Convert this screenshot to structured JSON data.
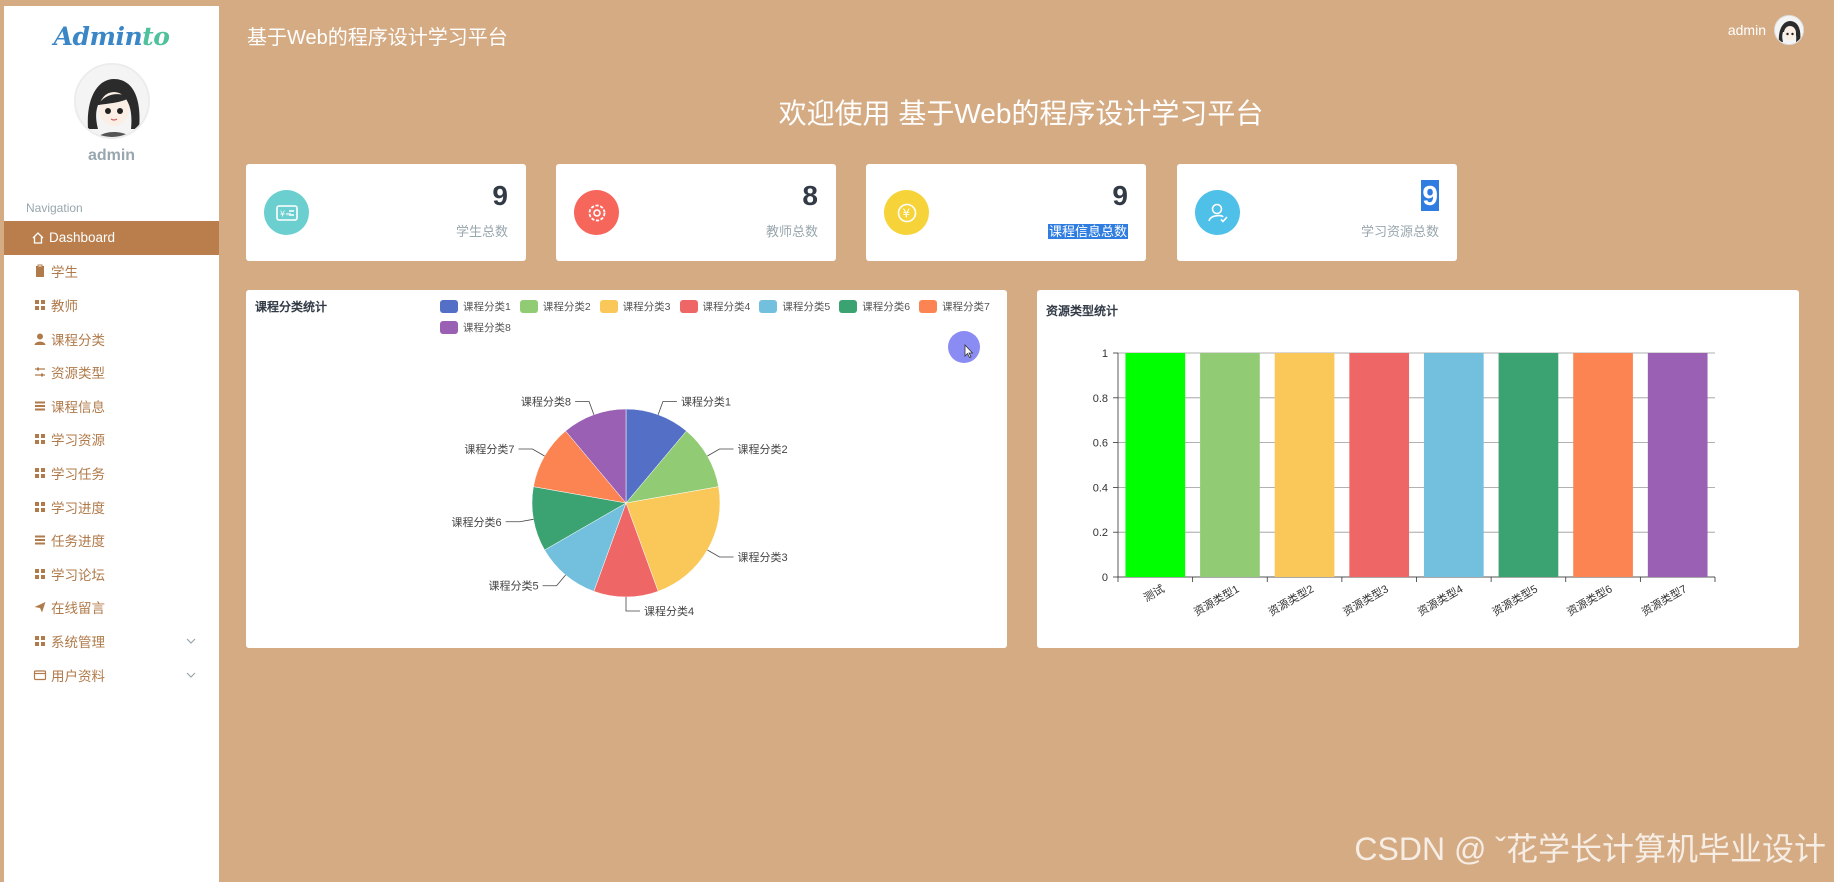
{
  "app": {
    "logo": {
      "part1": "Admin",
      "part2": "to"
    },
    "sidebar_username": "admin",
    "header_title": "基于Web的程序设计学习平台",
    "header_username": "admin",
    "welcome": "欢迎使用 基于Web的程序设计学习平台"
  },
  "nav": {
    "section_title": "Navigation",
    "items": [
      {
        "label": "Dashboard",
        "icon": "home-icon",
        "active": true
      },
      {
        "label": "学生",
        "icon": "clipboard-icon"
      },
      {
        "label": "教师",
        "icon": "grid-icon"
      },
      {
        "label": "课程分类",
        "icon": "user-icon"
      },
      {
        "label": "资源类型",
        "icon": "sliders-icon"
      },
      {
        "label": "课程信息",
        "icon": "list-icon"
      },
      {
        "label": "学习资源",
        "icon": "grid-icon"
      },
      {
        "label": "学习任务",
        "icon": "grid-icon"
      },
      {
        "label": "学习进度",
        "icon": "grid-icon"
      },
      {
        "label": "任务进度",
        "icon": "list-icon"
      },
      {
        "label": "学习论坛",
        "icon": "grid-icon"
      },
      {
        "label": "在线留言",
        "icon": "send-icon"
      },
      {
        "label": "系统管理",
        "icon": "grid-icon",
        "expandable": true
      },
      {
        "label": "用户资料",
        "icon": "card-icon",
        "expandable": true
      }
    ]
  },
  "stats": [
    {
      "value": "9",
      "label": "学生总数",
      "icon": "id-card-icon",
      "color": "#6ccfcf"
    },
    {
      "value": "8",
      "label": "教师总数",
      "icon": "gear-icon",
      "color": "#f7665b"
    },
    {
      "value": "9",
      "label": "课程信息总数",
      "icon": "yen-coin-icon",
      "color": "#f7d33a"
    },
    {
      "value": "9",
      "label": "学习资源总数",
      "icon": "user-check-icon",
      "color": "#4fc0e8"
    }
  ],
  "panels": {
    "pie_title": "课程分类统计",
    "bar_title": "资源类型统计"
  },
  "chart_data": [
    {
      "type": "pie",
      "title": "课程分类统计",
      "legend_position": "top",
      "categories": [
        "课程分类1",
        "课程分类2",
        "课程分类3",
        "课程分类4",
        "课程分类5",
        "课程分类6",
        "课程分类7",
        "课程分类8"
      ],
      "values": [
        1,
        1,
        2,
        1,
        1,
        1,
        1,
        1
      ],
      "colors": [
        "#5470c6",
        "#91cc75",
        "#fac858",
        "#ee6666",
        "#73c0de",
        "#3ba272",
        "#fc8452",
        "#9a60b4"
      ]
    },
    {
      "type": "bar",
      "title": "资源类型统计",
      "categories": [
        "测试",
        "资源类型1",
        "资源类型2",
        "资源类型3",
        "资源类型4",
        "资源类型5",
        "资源类型6",
        "资源类型7"
      ],
      "values": [
        1,
        1,
        1,
        1,
        1,
        1,
        1,
        1
      ],
      "colors": [
        "#00ff00",
        "#91cc75",
        "#fac858",
        "#ee6666",
        "#73c0de",
        "#3ba272",
        "#fc8452",
        "#9a60b4"
      ],
      "ylim": [
        0,
        1
      ],
      "yticks": [
        "0",
        "0.2",
        "0.4",
        "0.6",
        "0.8",
        "1"
      ],
      "grid": true
    }
  ],
  "watermark": "CSDN @ ˇ花学长计算机毕业设计"
}
